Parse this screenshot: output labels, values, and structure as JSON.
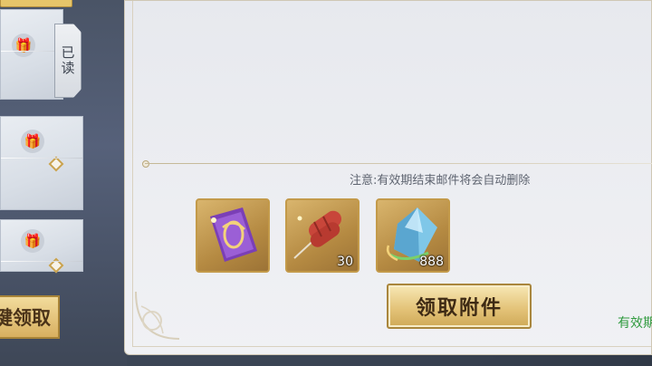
{
  "mail_list": {
    "items": [
      {
        "icon": "gift-icon",
        "state_label": "已读"
      },
      {
        "icon": "gift-icon"
      },
      {
        "icon": "gift-icon"
      }
    ],
    "claim_all_label": "一键领取"
  },
  "mail_detail": {
    "notice": "注意:有效期结束邮件将会自动删除",
    "attachments": [
      {
        "icon": "purple-scroll-icon",
        "count": ""
      },
      {
        "icon": "sausage-skewer-icon",
        "count": "30"
      },
      {
        "icon": "blue-crystal-icon",
        "count": "888"
      }
    ],
    "claim_button_label": "领取附件",
    "validity_label": "有效期"
  },
  "colors": {
    "gold_accent": "#c39a4a",
    "validity_green": "#2f9a3e",
    "panel_bg": "#eceef2"
  }
}
